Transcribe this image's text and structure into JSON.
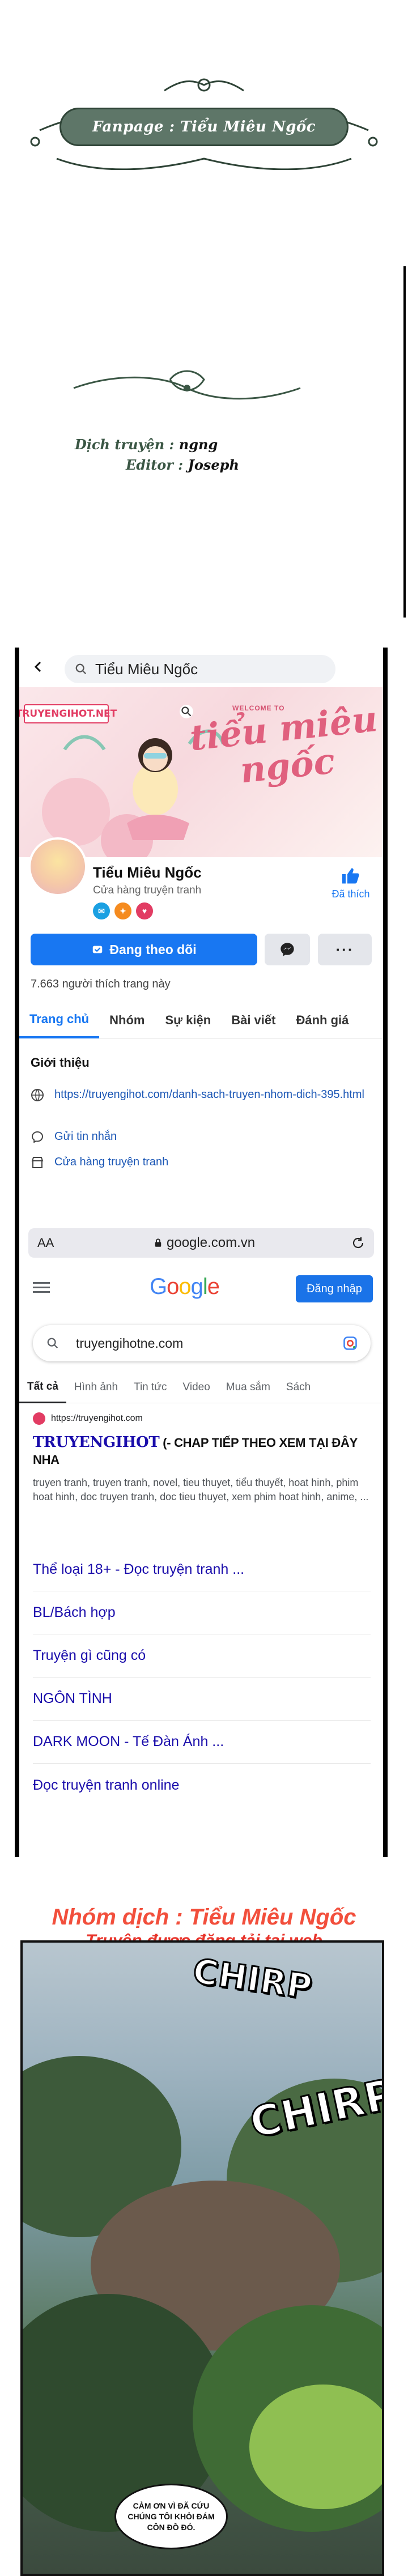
{
  "credits": {
    "fanpage": "Fanpage : Tiểu Miêu Ngốc",
    "translator_label": "Dịch truyện :",
    "translator_value": "ngng",
    "editor_label": "Editor :",
    "editor_value": "Joseph"
  },
  "facebook": {
    "search_text": "Tiểu Miêu Ngốc",
    "cover_logo": "TRUYENGIHOT.NET",
    "cover_welcome": "WELCOME TO",
    "cover_title": "tiểu miêu ngốc",
    "page_name": "Tiểu Miêu Ngốc",
    "page_category": "Cửa hàng truyện tranh",
    "like_label": "Đã thích",
    "follow_label": "Đang theo dõi",
    "more_label": "···",
    "visits": "7.663 người thích trang này",
    "tabs": [
      "Trang chủ",
      "Nhóm",
      "Sự kiện",
      "Bài viết",
      "Đánh giá"
    ],
    "intro_title": "Giới thiệu",
    "intro_link": "https://truyengihot.com/danh-sach-truyen-nhom-dich-395.html",
    "intro_message": "Gửi tin nhắn",
    "intro_shop": "Cửa hàng truyện tranh"
  },
  "browser": {
    "aa": "AA",
    "url": "google.com.vn"
  },
  "google": {
    "logo": "Google",
    "signin": "Đăng nhập",
    "query": "truyengihotne.com",
    "tabs": [
      "Tất cả",
      "Hình ảnh",
      "Tin tức",
      "Video",
      "Mua sắm",
      "Sách"
    ],
    "result": {
      "url": "https://truyengihot.com",
      "title": "TRUYENGIHOT",
      "promo": " (- CHAP TIẾP THEO XEM TẠI ĐÂY NHA",
      "snippet": "truyen tranh, truyen tranh, novel, tieu thuyet, tiểu thuyết, hoat hinh, phim hoat hinh, doc truyen tranh, doc tieu thuyet, xem phim hoat hinh, anime, ..."
    },
    "sitelinks": [
      "Thể loại 18+ - Đọc truyện tranh ...",
      "BL/Bách hợp",
      "Truyện gì cũng có",
      "NGÔN TÌNH",
      "DARK MOON - Tế Đàn Ánh ...",
      "Đọc truyện tranh online"
    ]
  },
  "comic": {
    "team": "Nhóm dịch : Tiểu Miêu Ngốc",
    "notice": "Truyện được đăng tải tại web TRUYENGIHOTDAY.NET",
    "sfx1": "CHIRP",
    "sfx2": "CHIRP",
    "bubble": "CẢM ƠN VÌ ĐÃ CỨU CHÚNG TÔI KHỎI ĐÁM CÔN ĐỒ ĐÓ."
  },
  "colors": {
    "facebook_blue": "#1877f2",
    "credit_green": "#5e7668",
    "comic_red": "#f24f3c",
    "google_link": "#1a0dab"
  }
}
